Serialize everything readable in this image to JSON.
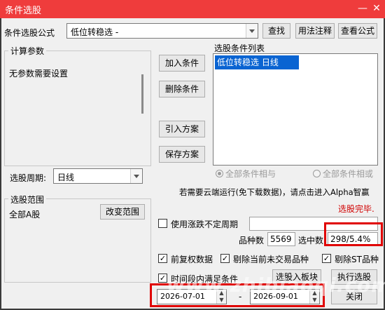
{
  "window": {
    "title": "条件选股"
  },
  "formula": {
    "label": "条件选股公式",
    "value": "低位转稳选  -",
    "find_button": "查找",
    "usage_button": "用法注释",
    "view_button": "查看公式"
  },
  "params": {
    "group_title": "计算参数",
    "message": "无参数需要设置"
  },
  "period": {
    "label": "选股周期:",
    "value": "日线"
  },
  "actions": {
    "add": "加入条件",
    "remove": "删除条件",
    "import": "引入方案",
    "save": "保存方案"
  },
  "conditions": {
    "title": "选股条件列表",
    "items": [
      "低位转稳选  日线"
    ]
  },
  "logic": {
    "and_label": "全部条件相与",
    "or_label": "全部条件相或",
    "selected": "and"
  },
  "cloud_notice": "若需要云端运行(免下载数据)，请点击进入Alpha智赢",
  "status": {
    "text": "选股完毕.",
    "color": "#d00000"
  },
  "scope": {
    "group_title": "选股范围",
    "value": "全部A股",
    "change_button": "改变范围"
  },
  "uncertain_period": {
    "label": "使用涨跌不定周期",
    "checked": false,
    "value": ""
  },
  "stats": {
    "count_label": "品种数",
    "count_value": "5569",
    "selected_label": "选中数",
    "selected_value": "298/5.4%"
  },
  "options": {
    "forward_adjust": {
      "label": "前复权数据",
      "checked": true,
      "mark": "✓"
    },
    "exclude_untraded": {
      "label": "剔除当前未交易品种",
      "checked": true,
      "mark": "✓"
    },
    "exclude_st": {
      "label": "剔除ST品种",
      "checked": true,
      "mark": "✓"
    },
    "time_range": {
      "label": "时间段内满足条件",
      "checked": true,
      "mark": "✓"
    }
  },
  "bottom_buttons": {
    "to_block": "选股入板块",
    "run": "执行选股",
    "close": "关闭"
  },
  "dates": {
    "start": "2026-07-01",
    "separator": "-",
    "end": "2026-09-01"
  },
  "watermark": "www.zhibiaoqi.com",
  "colors": {
    "title_bar": "#ef3c3c",
    "list_highlight": "#0a64d2",
    "annotation_box": "#e00000"
  }
}
